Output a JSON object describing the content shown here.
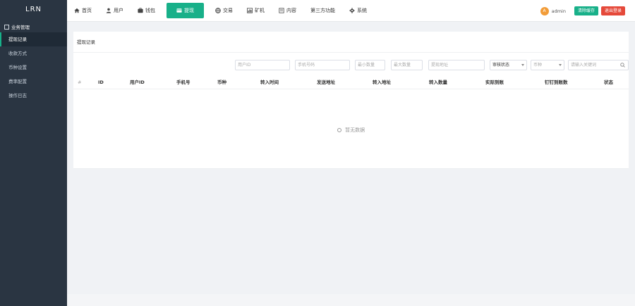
{
  "brand": "LRN",
  "sidebar": {
    "group": "业务管理",
    "items": [
      {
        "label": "提现记录",
        "active": true
      },
      {
        "label": "收款方式",
        "active": false
      },
      {
        "label": "币种设置",
        "active": false
      },
      {
        "label": "费率配置",
        "active": false
      },
      {
        "label": "操作日志",
        "active": false
      }
    ]
  },
  "nav": {
    "items": [
      {
        "label": "首页",
        "icon": "home-icon"
      },
      {
        "label": "用户",
        "icon": "user-icon"
      },
      {
        "label": "钱包",
        "icon": "wallet-icon"
      },
      {
        "label": "提现",
        "icon": "withdraw-icon",
        "active": true
      },
      {
        "label": "交易",
        "icon": "globe-icon"
      },
      {
        "label": "矿机",
        "icon": "chart-icon"
      },
      {
        "label": "内容",
        "icon": "book-icon"
      },
      {
        "label": "第三方功能",
        "icon": "",
        "active": false
      },
      {
        "label": "系统",
        "icon": "gear-icon"
      }
    ]
  },
  "topright": {
    "avatar_text": "A",
    "username": "admin",
    "btn_clear": "清除缓存",
    "btn_logout": "退出登录"
  },
  "breadcrumb": "提现记录",
  "filters": {
    "user_id": "用户ID",
    "phone": "手机号码",
    "min_amount": "最小数量",
    "max_amount": "最大数量",
    "address": "提现地址",
    "review_status": "审核状态",
    "coin": "币种",
    "search": "请输入关键词"
  },
  "table": {
    "headers": [
      "#",
      "ID",
      "用户ID",
      "手机号",
      "币种",
      "转入时间",
      "发送地址",
      "转入地址",
      "转入数量",
      "实际到账",
      "钉钉到账数",
      "状态"
    ],
    "empty_text": "暂无数据"
  },
  "colors": {
    "accent": "#18b089",
    "danger": "#e5493a",
    "sidebar_bg": "#2a3542"
  }
}
